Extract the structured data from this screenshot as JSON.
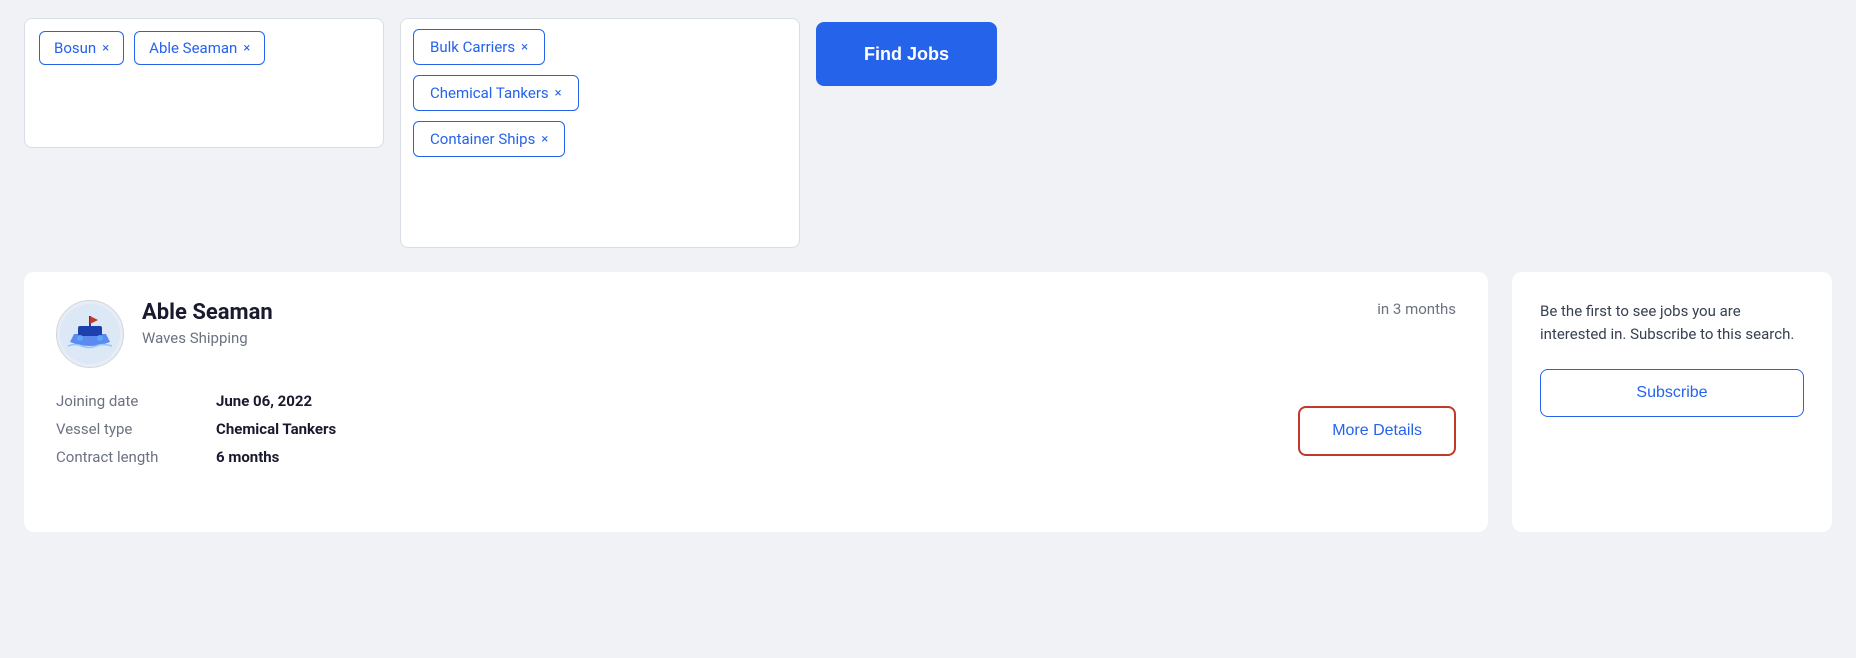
{
  "search": {
    "role_tags": [
      {
        "label": "Bosun",
        "id": "bosun-tag"
      },
      {
        "label": "Able Seaman",
        "id": "able-seaman-tag"
      }
    ],
    "vessel_tags": [
      {
        "label": "Bulk Carriers",
        "id": "bulk-carriers-tag"
      },
      {
        "label": "Chemical Tankers",
        "id": "chemical-tankers-tag"
      },
      {
        "label": "Container Ships",
        "id": "container-ships-tag"
      }
    ],
    "find_jobs_label": "Find Jobs"
  },
  "job": {
    "title": "Able Seaman",
    "company": "Waves Shipping",
    "timing": "in 3 months",
    "joining_date_label": "Joining date",
    "joining_date_value": "June 06, 2022",
    "vessel_type_label": "Vessel type",
    "vessel_type_value": "Chemical Tankers",
    "contract_length_label": "Contract length",
    "contract_length_value": "6 months",
    "more_details_label": "More Details"
  },
  "subscribe": {
    "text": "Be the first to see jobs you are interested in. Subscribe to this search.",
    "button_label": "Subscribe"
  }
}
